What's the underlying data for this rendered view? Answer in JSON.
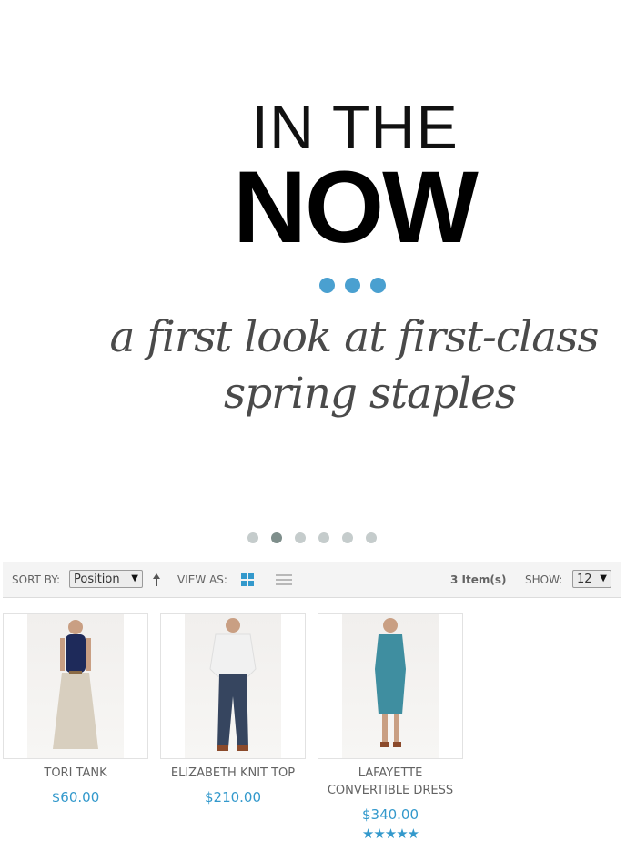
{
  "hero": {
    "line1": "IN THE",
    "line2": "NOW",
    "tagline_line1": "a first look at first-class",
    "tagline_line2": "spring staples",
    "accent_color": "#4aa0d0"
  },
  "slider": {
    "total_slides": 6,
    "active_slide": 2
  },
  "toolbar": {
    "sort_by_label": "Sort By:",
    "sort_value": "Position",
    "view_as_label": "View as:",
    "items_count": "3 Item(s)",
    "show_label": "Show:",
    "show_value": "12"
  },
  "products": [
    {
      "name": "Tori Tank",
      "name_line2": "",
      "price": "$60.00",
      "rating": "",
      "figure_top": "#1e2a5a",
      "figure_bottom": "#d8cfbf"
    },
    {
      "name": "Elizabeth Knit Top",
      "name_line2": "",
      "price": "$210.00",
      "rating": "",
      "figure_top": "#f3f3f3",
      "figure_bottom": "#36455f"
    },
    {
      "name": "Lafayette",
      "name_line2": "Convertible Dress",
      "price": "$340.00",
      "rating": "★★★★★",
      "figure_top": "#3f8ea0",
      "figure_bottom": "#3f8ea0"
    }
  ]
}
